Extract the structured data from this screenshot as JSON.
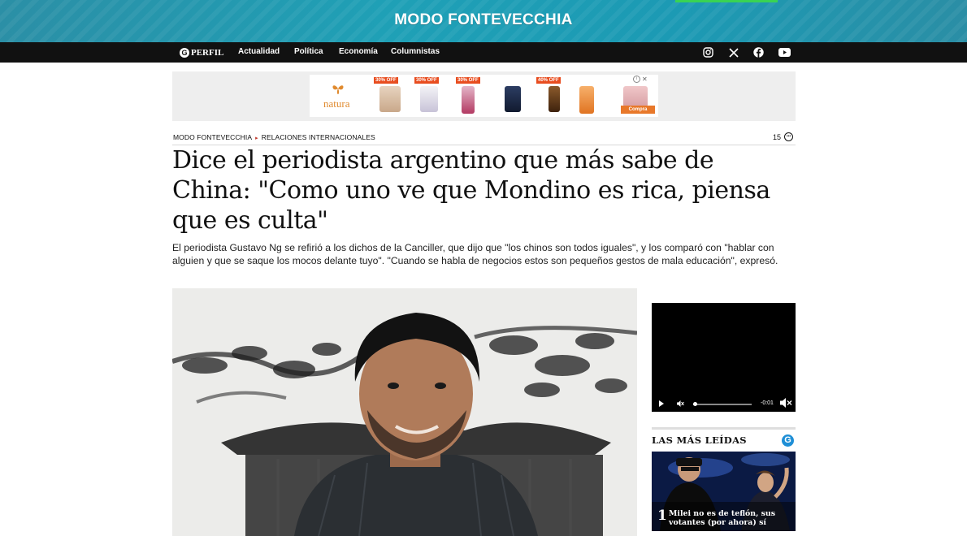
{
  "header": {
    "brand": "MODO FONTEVECCHIA",
    "accent_color": "#39d353"
  },
  "navbar": {
    "logo_text": "PERFIL",
    "links": [
      "Actualidad",
      "Política",
      "Economía",
      "Columnistas"
    ],
    "social_icons": [
      "instagram-icon",
      "x-icon",
      "facebook-icon",
      "youtube-icon"
    ]
  },
  "ad": {
    "brand": "natura",
    "badges": [
      "30% OFF",
      "30% OFF",
      "30% OFF",
      "40% OFF"
    ],
    "cta": "Compra",
    "close": "✕"
  },
  "article": {
    "breadcrumb": [
      "MODO FONTEVECCHIA",
      "RELACIONES INTERNACIONALES"
    ],
    "comment_count": "15",
    "title": "Dice el periodista argentino que más sabe de China: \"Como uno ve que Mondino es rica, piensa que es culta\"",
    "dek": "El periodista Gustavo Ng se refirió a los dichos de la Canciller, que dijo que \"los chinos son todos iguales\", y los comparó con \"hablar con alguien y que se saque los mocos delante tuyo\". \"Cuando se habla de negocios estos son pequeños gestos de mala educación\", expresó."
  },
  "video": {
    "time": "-0:01",
    "progress": 0.03
  },
  "most_read": {
    "title": "LAS MÁS LEÍDAS",
    "items": [
      {
        "rank": "1",
        "headline": "Milei no es de teflón, sus votantes (por ahora) sí"
      }
    ]
  },
  "colors": {
    "banner": "#1fa0b6",
    "navbar": "#111111",
    "ad_badge": "#e84d1f",
    "perfil_blue": "#1f8fd6"
  }
}
